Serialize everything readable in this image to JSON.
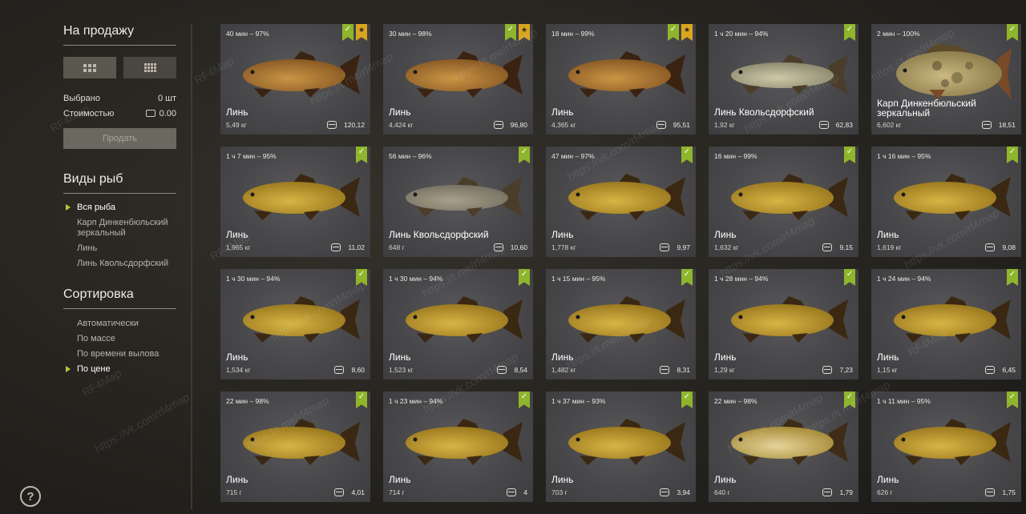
{
  "sidebar": {
    "sale_title": "На продажу",
    "selected_label": "Выбрано",
    "selected_value": "0 шт",
    "cost_label": "Стоимостью",
    "cost_value": "0.00",
    "sell_button": "Продать",
    "species_title": "Виды рыб",
    "species": [
      {
        "label": "Вся рыба",
        "active": true
      },
      {
        "label": "Карп Динкенбюльский зеркальный",
        "active": false
      },
      {
        "label": "Линь",
        "active": false
      },
      {
        "label": "Линь Квольсдорфский",
        "active": false
      }
    ],
    "sort_title": "Сортировка",
    "sort": [
      {
        "label": "Автоматически",
        "active": false
      },
      {
        "label": "По массе",
        "active": false
      },
      {
        "label": "По времени вылова",
        "active": false
      },
      {
        "label": "По цене",
        "active": true
      }
    ],
    "help_label": "?"
  },
  "watermarks": [
    "RF4Map",
    "https://vk.com/rf4map",
    "https://t.me/rf4map"
  ],
  "fish_cards": [
    {
      "time": "40 мин – 97%",
      "name": "Линь",
      "weight": "5,49 кг",
      "price": "120,12",
      "star": true,
      "kind": "tench-dark"
    },
    {
      "time": "30 мин – 98%",
      "name": "Линь",
      "weight": "4,424 кг",
      "price": "96,80",
      "star": true,
      "kind": "tench-dark"
    },
    {
      "time": "18 мин – 99%",
      "name": "Линь",
      "weight": "4,365 кг",
      "price": "95,51",
      "star": true,
      "kind": "tench-dark"
    },
    {
      "time": "1 ч 20 мин – 94%",
      "name": "Линь Квольсдорфский",
      "weight": "1,92 кг",
      "price": "62,83",
      "star": false,
      "kind": "kw-silver"
    },
    {
      "time": "2 мин – 100%",
      "name": "Карп Динкенбюльский зеркальный",
      "weight": "6,602 кг",
      "price": "18,51",
      "star": false,
      "kind": "carp"
    },
    {
      "time": "1 ч 7 мин – 95%",
      "name": "Линь",
      "weight": "1,965 кг",
      "price": "11,02",
      "star": false,
      "kind": "tench"
    },
    {
      "time": "56 мин – 96%",
      "name": "Линь Квольсдорфский",
      "weight": "648 г",
      "price": "10,60",
      "star": false,
      "kind": "kw-grey"
    },
    {
      "time": "47 мин – 97%",
      "name": "Линь",
      "weight": "1,778 кг",
      "price": "9,97",
      "star": false,
      "kind": "tench"
    },
    {
      "time": "16 мин – 99%",
      "name": "Линь",
      "weight": "1,632 кг",
      "price": "9,15",
      "star": false,
      "kind": "tench"
    },
    {
      "time": "1 ч 16 мин – 95%",
      "name": "Линь",
      "weight": "1,619 кг",
      "price": "9,08",
      "star": false,
      "kind": "tench"
    },
    {
      "time": "1 ч 30 мин – 94%",
      "name": "Линь",
      "weight": "1,534 кг",
      "price": "8,60",
      "star": false,
      "kind": "tench"
    },
    {
      "time": "1 ч 30 мин – 94%",
      "name": "Линь",
      "weight": "1,523 кг",
      "price": "8,54",
      "star": false,
      "kind": "tench"
    },
    {
      "time": "1 ч 15 мин – 95%",
      "name": "Линь",
      "weight": "1,482 кг",
      "price": "8,31",
      "star": false,
      "kind": "tench"
    },
    {
      "time": "1 ч 28 мин – 94%",
      "name": "Линь",
      "weight": "1,29 кг",
      "price": "7,23",
      "star": false,
      "kind": "tench"
    },
    {
      "time": "1 ч 24 мин – 94%",
      "name": "Линь",
      "weight": "1,15 кг",
      "price": "6,45",
      "star": false,
      "kind": "tench"
    },
    {
      "time": "22 мин – 98%",
      "name": "Линь",
      "weight": "715 г",
      "price": "4,01",
      "star": false,
      "kind": "tench"
    },
    {
      "time": "1 ч 23 мин – 94%",
      "name": "Линь",
      "weight": "714 г",
      "price": "4",
      "star": false,
      "kind": "tench"
    },
    {
      "time": "1 ч 37 мин – 93%",
      "name": "Линь",
      "weight": "703 г",
      "price": "3,94",
      "star": false,
      "kind": "tench"
    },
    {
      "time": "22 мин – 98%",
      "name": "Линь",
      "weight": "640 г",
      "price": "1,79",
      "star": false,
      "kind": "tench-pale"
    },
    {
      "time": "1 ч 11 мин – 95%",
      "name": "Линь",
      "weight": "626 г",
      "price": "1,75",
      "star": false,
      "kind": "tench"
    }
  ],
  "colors": {
    "accent_green": "#8fb52d",
    "star_gold": "#d9a51f",
    "card_bg": "#4a494c",
    "sidebar_arrow": "#b5c93a"
  }
}
